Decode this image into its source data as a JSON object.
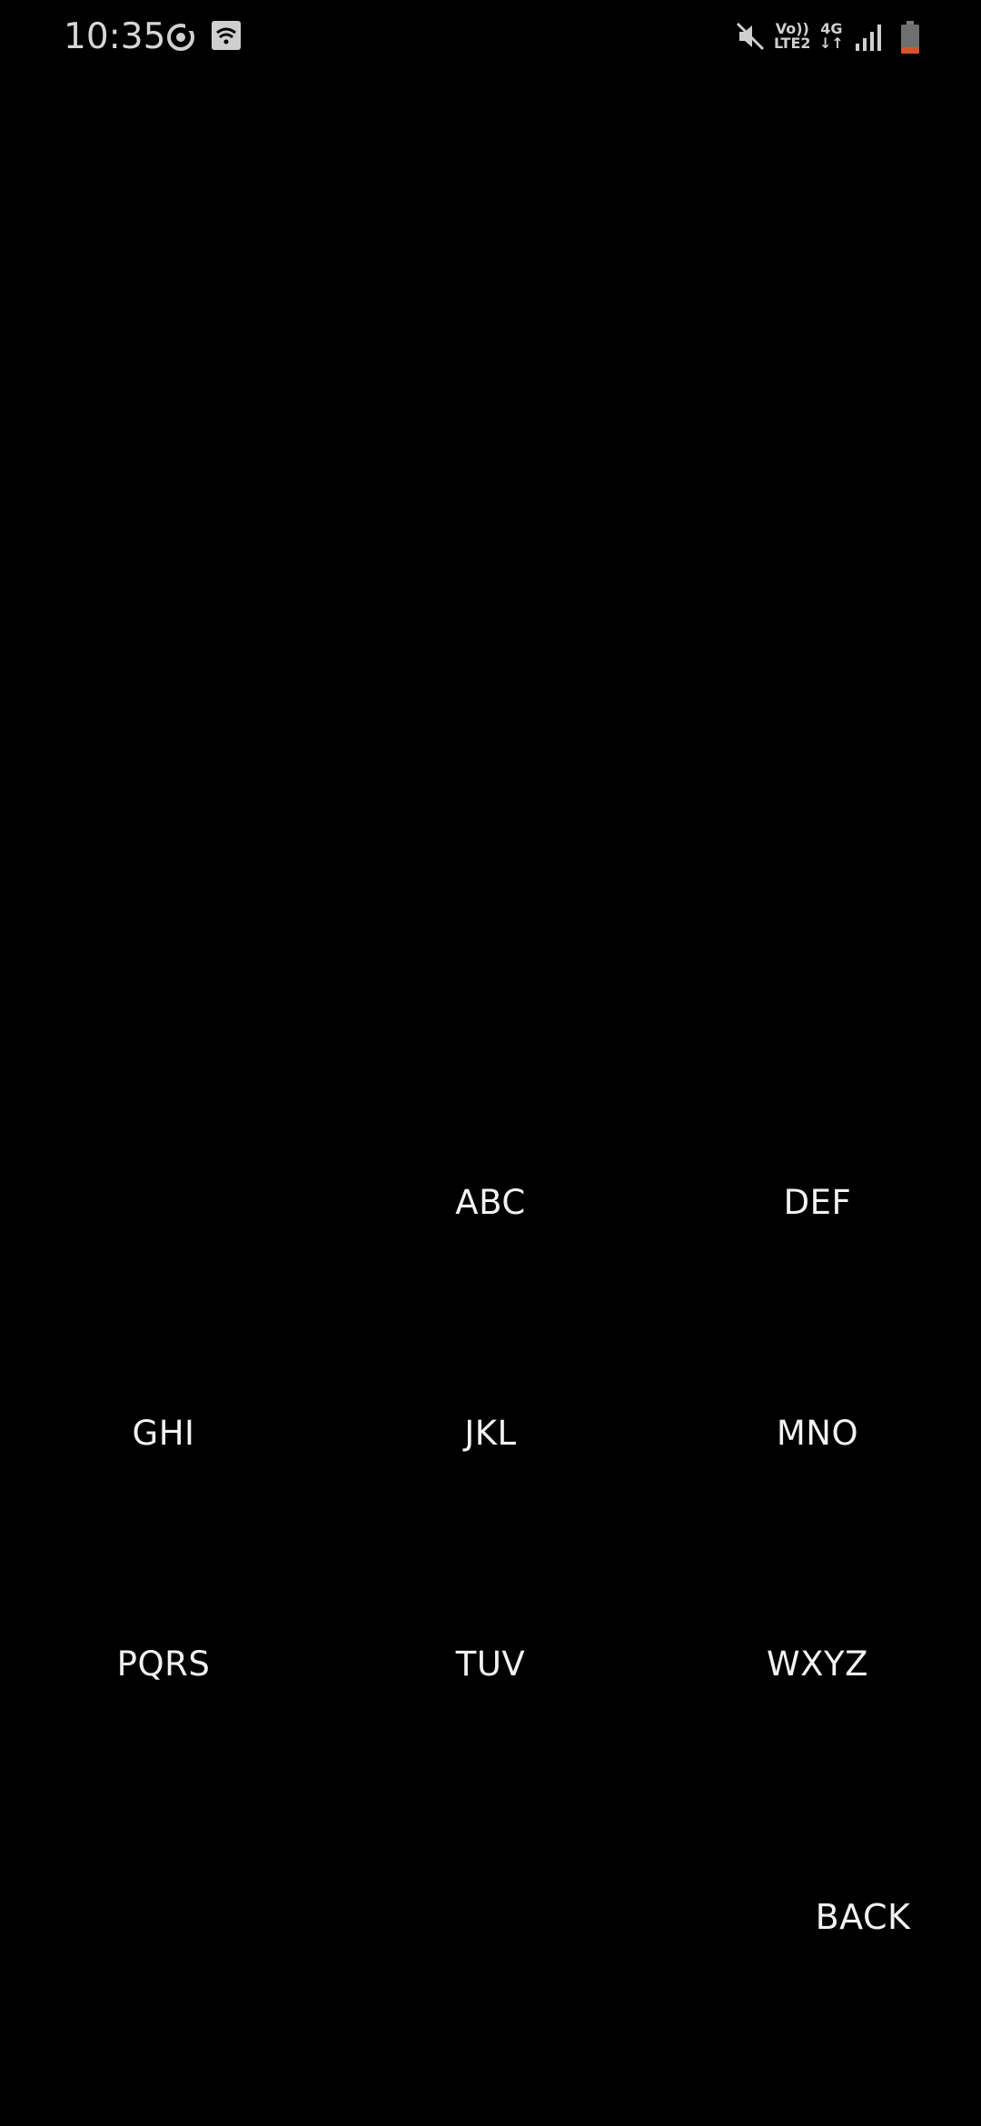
{
  "status_bar": {
    "time": "10:35",
    "volte_top": "Vo))",
    "volte_bottom": "LTE2",
    "network_type": "4G",
    "battery_color": "#d9542b"
  },
  "keypad": {
    "rows": [
      [
        "",
        "ABC",
        "DEF"
      ],
      [
        "GHI",
        "JKL",
        "MNO"
      ],
      [
        "PQRS",
        "TUV",
        "WXYZ"
      ]
    ],
    "back_label": "BACK"
  }
}
